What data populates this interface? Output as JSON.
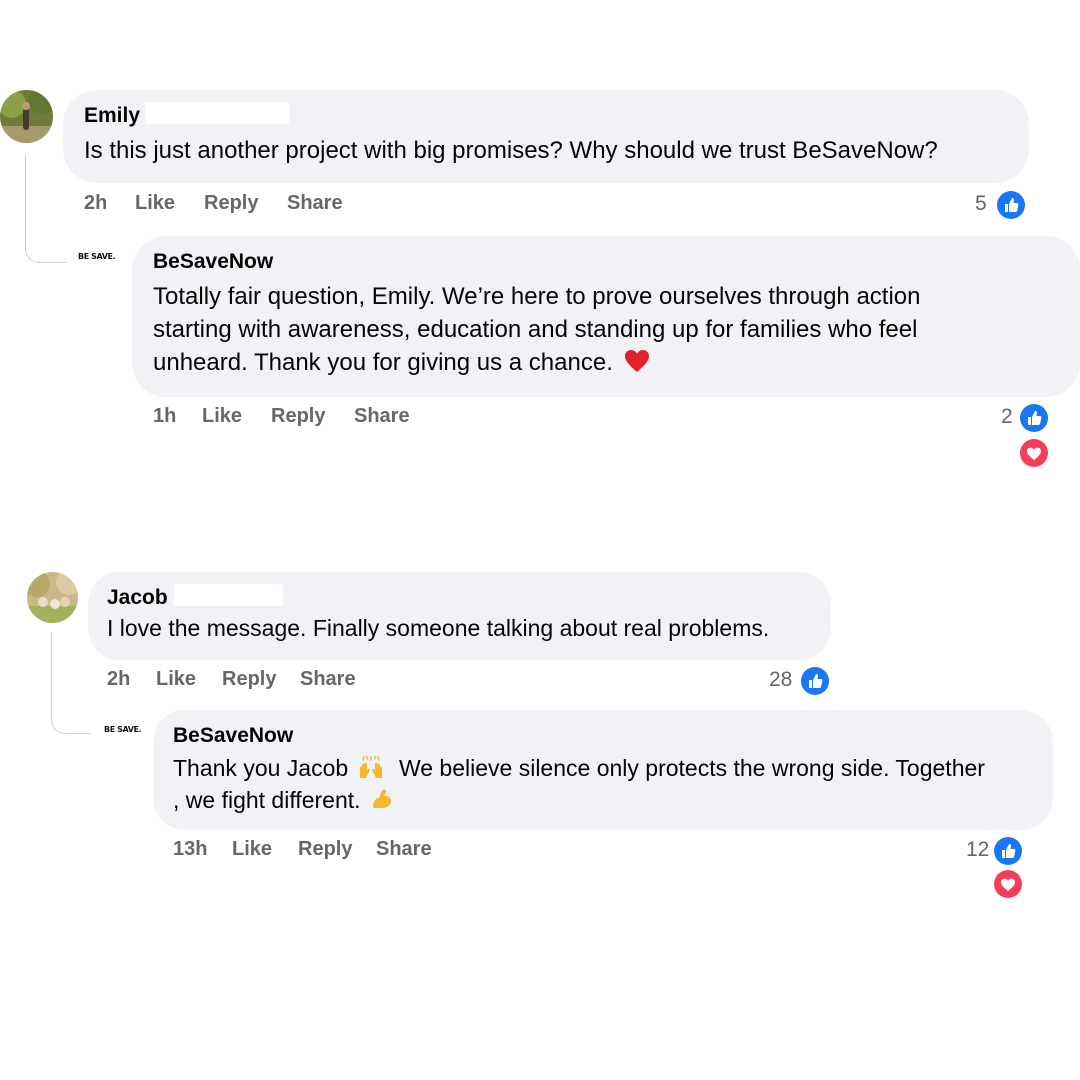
{
  "comments": [
    {
      "author": "Emily",
      "text": "Is this just another project with big promises? Why should we trust BeSaveNow?",
      "time": "2h",
      "like_label": "Like",
      "reply_label": "Reply",
      "share_label": "Share",
      "like_count": "5"
    },
    {
      "author": "BeSaveNow",
      "logo_text": "BE SAVE.",
      "text_lines": [
        "Totally fair question, Emily. We’re here to prove ourselves through action",
        "starting with awareness, education and standing up for families who feel",
        "unheard. Thank you for giving us a chance."
      ],
      "time": "1h",
      "like_label": "Like",
      "reply_label": "Reply",
      "share_label": "Share",
      "like_count": "2"
    },
    {
      "author": "Jacob",
      "text": "I love the message. Finally someone talking about real problems.",
      "time": "2h",
      "like_label": "Like",
      "reply_label": "Reply",
      "share_label": "Share",
      "like_count": "28"
    },
    {
      "author": "BeSaveNow",
      "logo_text": "BE SAVE.",
      "text_line1": "Thank you Jacob",
      "text_line1b": "We believe silence only protects the wrong side. Together",
      "text_line2": ", we fight different.",
      "time": "13h",
      "like_label": "Like",
      "reply_label": "Reply",
      "share_label": "Share",
      "like_count": "12"
    }
  ],
  "icons": {
    "like": "thumbs-up-icon",
    "love": "heart-icon",
    "like_color": "#1877f2",
    "love_color": "#f33e58"
  }
}
